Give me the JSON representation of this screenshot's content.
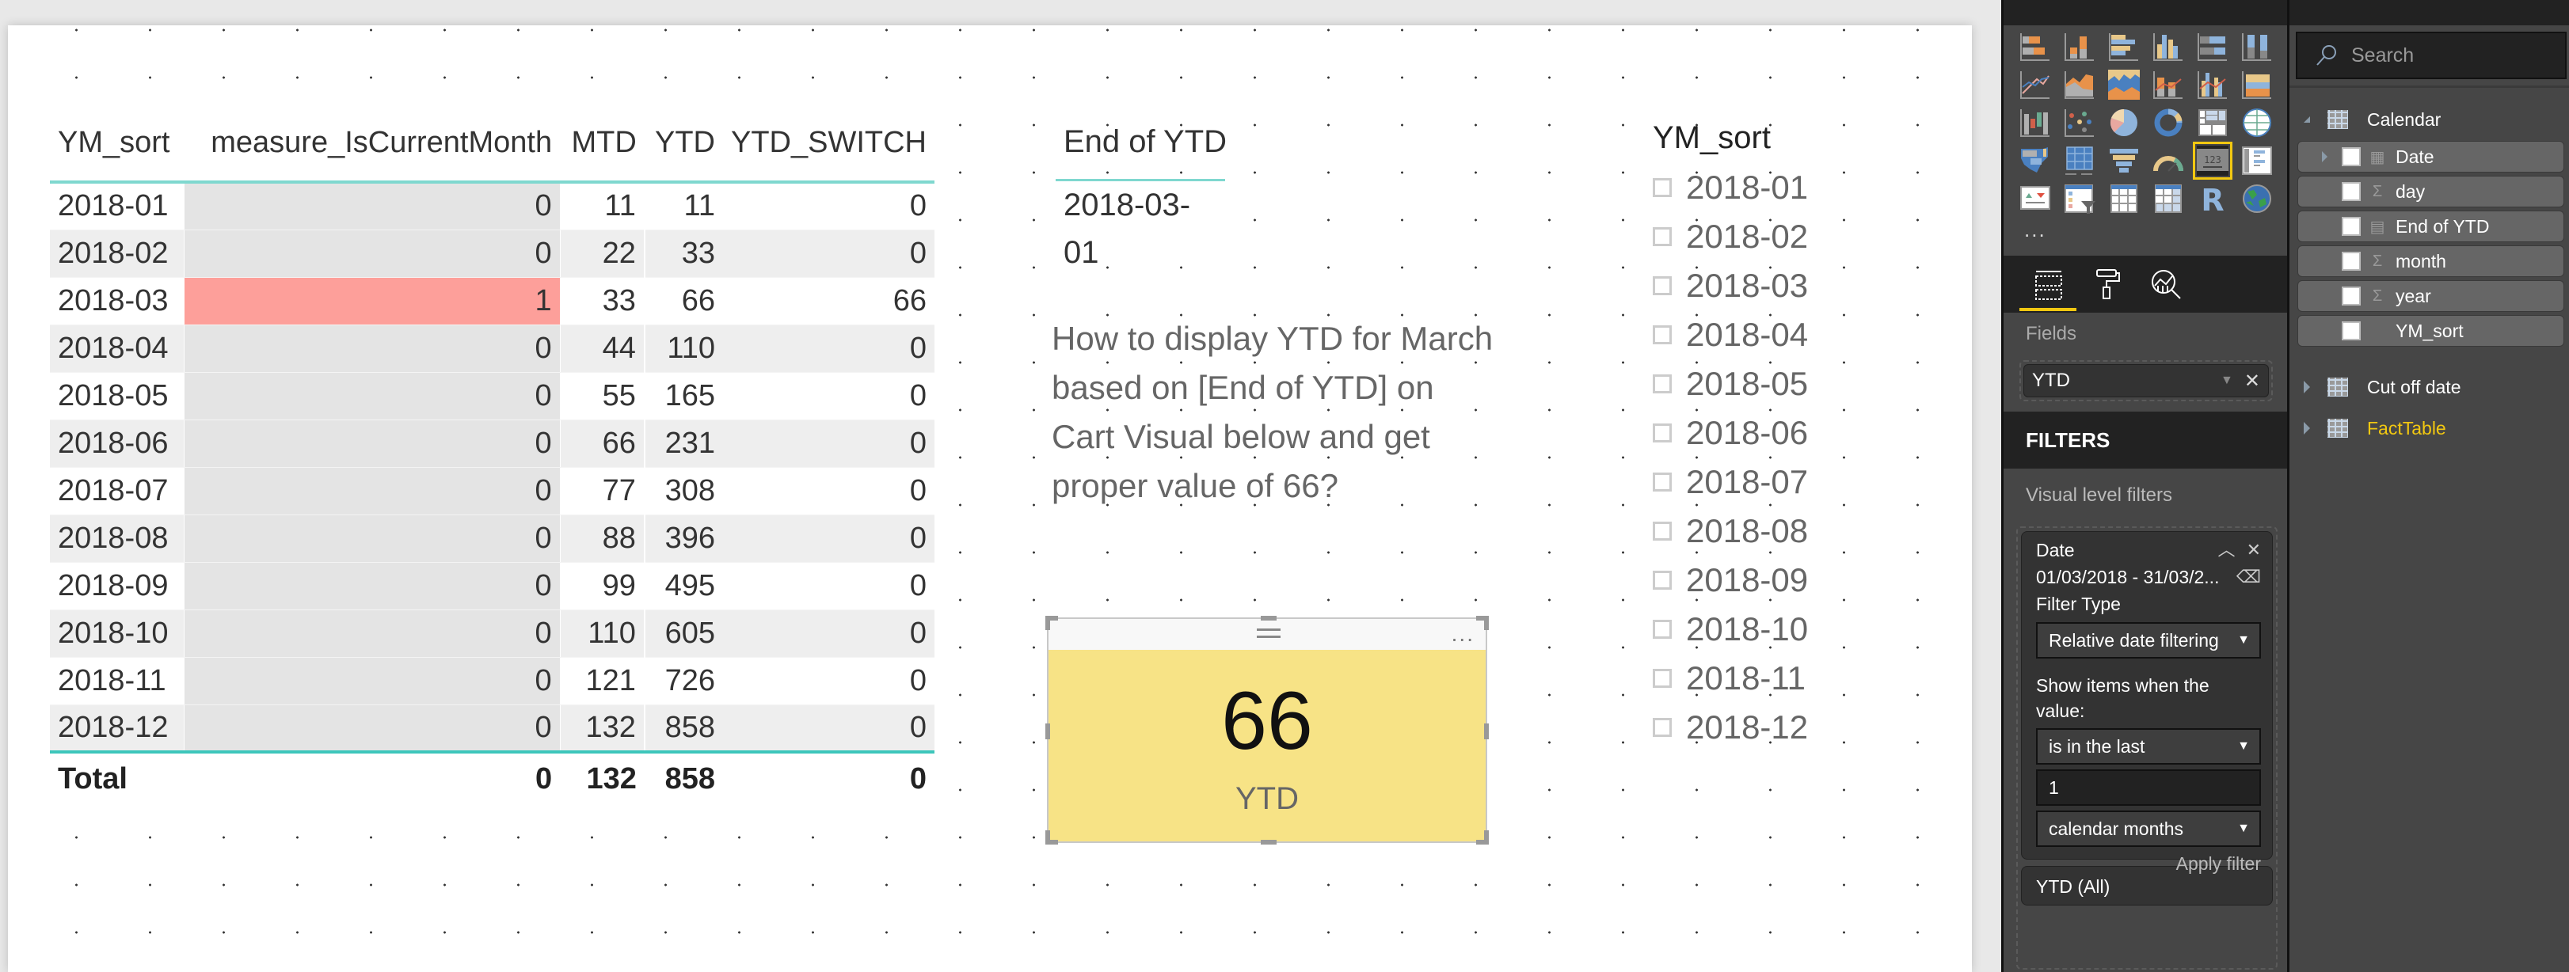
{
  "table": {
    "columns": [
      "YM_sort",
      "measure_IsCurrentMonth",
      "MTD",
      "YTD",
      "YTD_SWITCH"
    ],
    "rows": [
      {
        "ym": "2018-01",
        "measure": "0",
        "mtd": "11",
        "ytd": "11",
        "switch": "0",
        "highlight": false
      },
      {
        "ym": "2018-02",
        "measure": "0",
        "mtd": "22",
        "ytd": "33",
        "switch": "0",
        "highlight": false
      },
      {
        "ym": "2018-03",
        "measure": "1",
        "mtd": "33",
        "ytd": "66",
        "switch": "66",
        "highlight": true
      },
      {
        "ym": "2018-04",
        "measure": "0",
        "mtd": "44",
        "ytd": "110",
        "switch": "0",
        "highlight": false
      },
      {
        "ym": "2018-05",
        "measure": "0",
        "mtd": "55",
        "ytd": "165",
        "switch": "0",
        "highlight": false
      },
      {
        "ym": "2018-06",
        "measure": "0",
        "mtd": "66",
        "ytd": "231",
        "switch": "0",
        "highlight": false
      },
      {
        "ym": "2018-07",
        "measure": "0",
        "mtd": "77",
        "ytd": "308",
        "switch": "0",
        "highlight": false
      },
      {
        "ym": "2018-08",
        "measure": "0",
        "mtd": "88",
        "ytd": "396",
        "switch": "0",
        "highlight": false
      },
      {
        "ym": "2018-09",
        "measure": "0",
        "mtd": "99",
        "ytd": "495",
        "switch": "0",
        "highlight": false
      },
      {
        "ym": "2018-10",
        "measure": "0",
        "mtd": "110",
        "ytd": "605",
        "switch": "0",
        "highlight": false
      },
      {
        "ym": "2018-11",
        "measure": "0",
        "mtd": "121",
        "ytd": "726",
        "switch": "0",
        "highlight": false
      },
      {
        "ym": "2018-12",
        "measure": "0",
        "mtd": "132",
        "ytd": "858",
        "switch": "0",
        "highlight": false
      }
    ],
    "total": {
      "label": "Total",
      "measure": "0",
      "mtd": "132",
      "ytd": "858",
      "switch": "0"
    },
    "highlight_color": "#fd9f9a",
    "header_line_color": "#7fd8cf"
  },
  "end_of_ytd": {
    "title": "End of YTD",
    "value": "2018-03-01"
  },
  "textbox": {
    "text": "How to display YTD for March based on [End of YTD] on Cart Visual below and get proper value of 66?"
  },
  "card": {
    "value": "66",
    "label": "YTD",
    "more_label": "...",
    "background": "#f7e386"
  },
  "slicer": {
    "title": "YM_sort",
    "items": [
      "2018-01",
      "2018-02",
      "2018-03",
      "2018-04",
      "2018-05",
      "2018-06",
      "2018-07",
      "2018-08",
      "2018-09",
      "2018-10",
      "2018-11",
      "2018-12"
    ]
  },
  "viz_pane": {
    "icons": [
      "stacked-bar-chart",
      "stacked-column-chart",
      "clustered-bar-chart",
      "clustered-column-chart",
      "100-stacked-bar-chart",
      "100-stacked-column-chart",
      "line-chart",
      "area-chart",
      "stacked-area-chart",
      "line-and-stacked-column-chart",
      "line-and-clustered-column-chart",
      "ribbon-chart",
      "waterfall-chart",
      "scatter-chart",
      "pie-chart",
      "donut-chart",
      "treemap",
      "map",
      "filled-map",
      "shape-map",
      "funnel",
      "gauge",
      "card",
      "multi-row-card",
      "kpi",
      "slicer",
      "table",
      "matrix",
      "r-script-visual",
      "arcgis-map"
    ],
    "selected_icon": "card",
    "more_label": "...",
    "tabs": [
      "fields-tab",
      "format-tab",
      "analytics-tab"
    ],
    "active_tab": "fields-tab",
    "fields_label": "Fields",
    "field_well_value": "YTD",
    "filters_header": "FILTERS",
    "visual_level_filters": "Visual level filters",
    "date_filter": {
      "name": "Date",
      "range": "01/03/2018 - 31/03/2...",
      "filter_type_label": "Filter Type",
      "filter_type": "Relative date filtering",
      "show_items_label": "Show items when the value:",
      "operator": "is in the last",
      "amount": "1",
      "unit": "calendar months",
      "apply_label": "Apply filter"
    },
    "ytd_filter": "YTD (All)",
    "accent_color": "#f2c811"
  },
  "fields_pane": {
    "search_placeholder": "Search",
    "tables": [
      {
        "name": "Calendar",
        "expanded": true,
        "fields": [
          {
            "name": "Date",
            "type": "calendar",
            "expandable": true
          },
          {
            "name": "day",
            "type": "sigma",
            "expandable": false
          },
          {
            "name": "End of YTD",
            "type": "calculator",
            "expandable": false
          },
          {
            "name": "month",
            "type": "sigma",
            "expandable": false
          },
          {
            "name": "year",
            "type": "sigma",
            "expandable": false
          },
          {
            "name": "YM_sort",
            "type": "none",
            "expandable": false
          }
        ]
      },
      {
        "name": "Cut off date",
        "expanded": false
      },
      {
        "name": "FactTable",
        "expanded": false,
        "accent": true
      }
    ]
  }
}
